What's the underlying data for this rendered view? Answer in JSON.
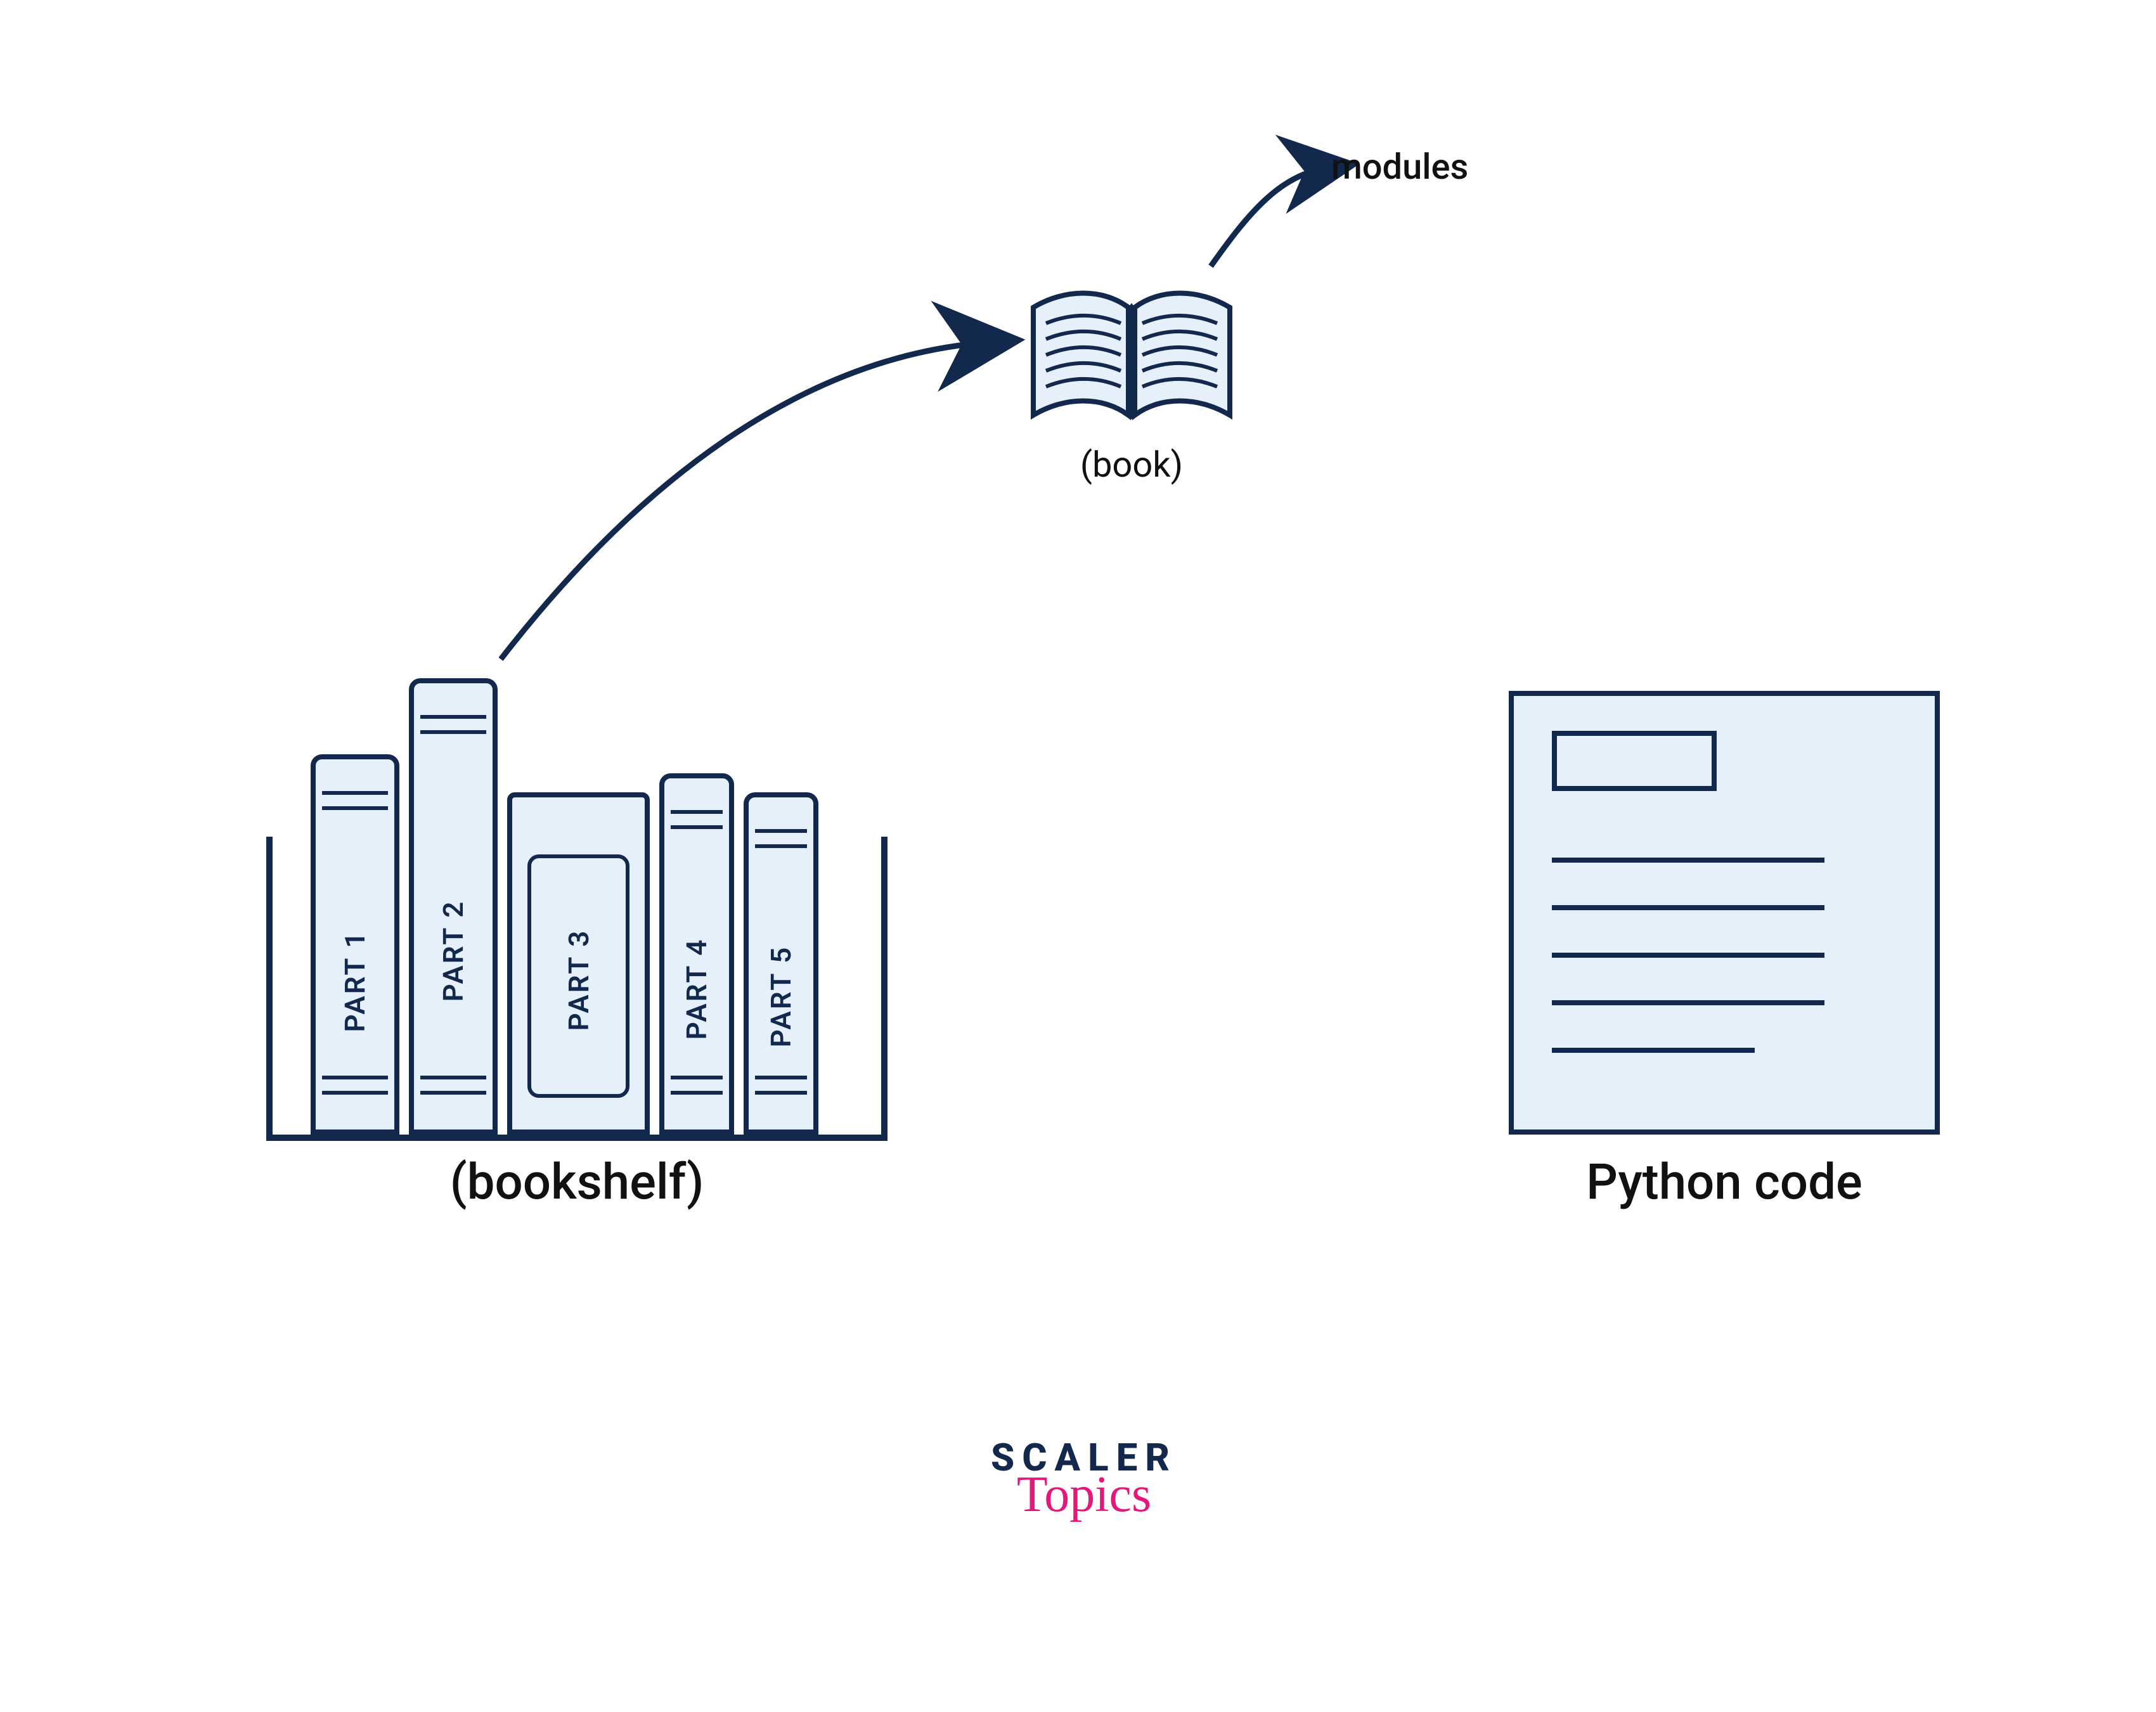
{
  "bookshelf": {
    "label": "(bookshelf)",
    "books": [
      {
        "label": "PART 1"
      },
      {
        "label": "PART 2"
      },
      {
        "label": "PART 3"
      },
      {
        "label": "PART 4"
      },
      {
        "label": "PART 5"
      }
    ]
  },
  "openbook": {
    "label": "(book)"
  },
  "modules_label": "modules",
  "document": {
    "label": "Python code"
  },
  "logo": {
    "line1": "SCALER",
    "line2": "Topics"
  },
  "colors": {
    "stroke": "#12284C",
    "fill": "#E5F0FA",
    "accent": "#E6177B"
  }
}
